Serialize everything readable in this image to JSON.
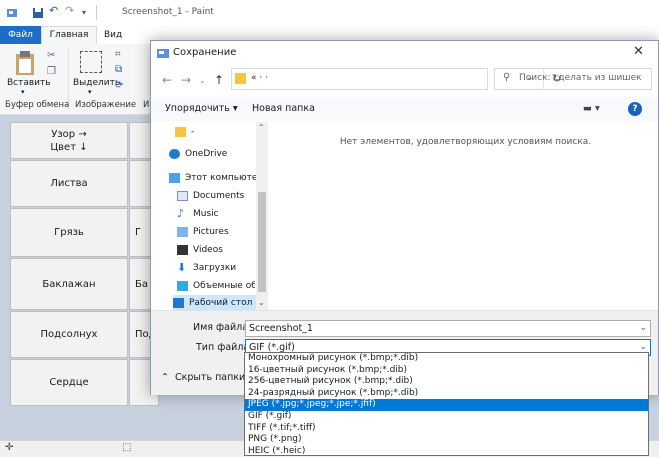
{
  "paint": {
    "title": "Screenshot_1 - Paint",
    "tabs": [
      "Файл",
      "Главная",
      "Вид"
    ],
    "ribbon": {
      "paste_label": "Вставить",
      "select_label": "Выделить",
      "groups": [
        "Буфер обмена",
        "Изображение",
        "И"
      ]
    },
    "grid_header": "Узор →\nЦвет ↓",
    "rows": [
      "Листва",
      "Грязь",
      "Баклажан",
      "Подсолнух",
      "Сердце"
    ],
    "col2_partials": [
      "",
      "",
      "Г",
      "Ба",
      "Под",
      ""
    ]
  },
  "dialog": {
    "title": "Сохранение",
    "address": "«   ·   ·",
    "search_placeholder": "Поиск: сделать из шишек",
    "organize_label": "Упорядочить",
    "new_folder_label": "Новая папка",
    "nav_items": [
      "-",
      "OneDrive",
      "Этот компьютер",
      "Documents",
      "Music",
      "Pictures",
      "Videos",
      "Загрузки",
      "Объемные объекты",
      "Рабочий стол"
    ],
    "empty_message": "Нет элементов, удовлетворяющих условиям поиска.",
    "filename_label": "Имя файла:",
    "filename_value": "Screenshot_1",
    "filetype_label": "Тип файла:",
    "filetype_value": "GIF (*.gif)",
    "hide_folders_label": "Скрыть папки",
    "type_options": [
      "Монохромный рисунок (*.bmp;*.dib)",
      "16-цветный рисунок (*.bmp;*.dib)",
      "256-цветный рисунок (*.bmp;*.dib)",
      "24-разрядный рисунок (*.bmp;*.dib)",
      "JPEG (*.jpg;*.jpeg;*.jpe;*.jfif)",
      "GIF (*.gif)",
      "TIFF (*.tif;*.tiff)",
      "PNG (*.png)",
      "HEIC (*.heic)"
    ],
    "selected_option_index": 4
  },
  "colors": {
    "accent": "#0078d7",
    "file_tab": "#1d6dc6"
  }
}
